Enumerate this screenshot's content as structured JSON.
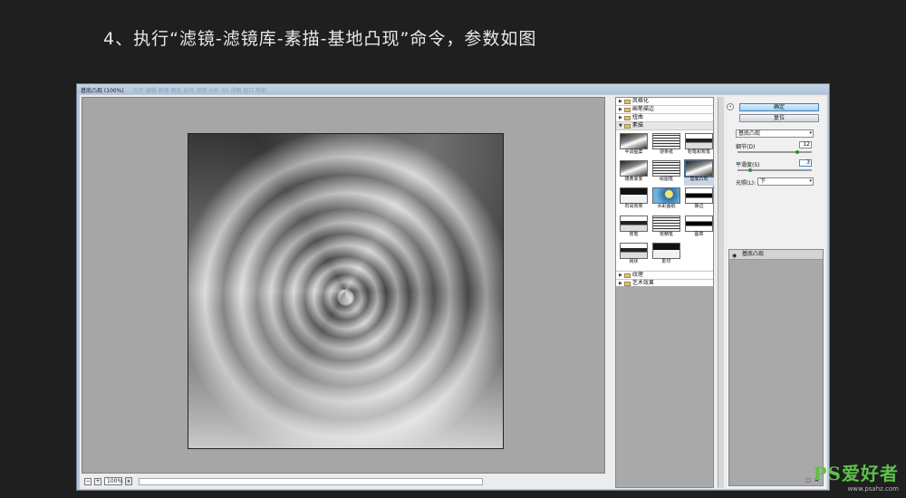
{
  "instruction": "4、执行“滤镜-滤镜库-素描-基地凸现”命令，参数如图",
  "dialog": {
    "title": "基底凸现 (100%)",
    "title_ghost": "文件 编辑 图像 图层 选择 滤镜 分析 3D 视图 窗口 帮助"
  },
  "statusbar": {
    "minus": "−",
    "plus": "+",
    "zoom": "100%",
    "dropdown": "▾"
  },
  "gallery": {
    "categories_top": [
      {
        "label": "风格化"
      },
      {
        "label": "画笔描边"
      },
      {
        "label": "扭曲"
      }
    ],
    "open_category": "素描",
    "thumbnails": [
      {
        "label": "半调图案",
        "style": "s1"
      },
      {
        "label": "便条纸",
        "style": "s2"
      },
      {
        "label": "粉笔和炭笔",
        "style": "s3"
      },
      {
        "label": "铬黄渐变",
        "style": "s1"
      },
      {
        "label": "绘图笔",
        "style": "s2"
      },
      {
        "label": "基底凸现",
        "style": "s1",
        "selected": true
      },
      {
        "label": "石膏效果",
        "style": "s4"
      },
      {
        "label": "水彩画纸",
        "style": "s5"
      },
      {
        "label": "撕边",
        "style": "s6"
      },
      {
        "label": "炭笔",
        "style": "s3"
      },
      {
        "label": "炭精笔",
        "style": "s2"
      },
      {
        "label": "图章",
        "style": "s6"
      },
      {
        "label": "网状",
        "style": "s3"
      },
      {
        "label": "影印",
        "style": "s4"
      }
    ],
    "categories_bottom": [
      {
        "label": "纹理"
      },
      {
        "label": "艺术效果"
      }
    ]
  },
  "settings": {
    "ok_label": "确定",
    "reset_label": "复位",
    "toggle_label": "«",
    "filter_select": "基底凸现",
    "detail_label": "细节(D)",
    "detail_value": "12",
    "detail_fraction": 0.8,
    "smooth_label": "平滑度(S)",
    "smooth_value": "3",
    "smooth_fraction": 0.15,
    "light_label": "光照(L):",
    "light_value": "下",
    "layer_name": "基底凸现",
    "layer_new_icon": "□",
    "layer_delete_icon": "✖"
  },
  "icons": {
    "collapsed": "▶",
    "expanded": "▼",
    "eye": "◉"
  },
  "watermark": {
    "logo": "PS爱好者",
    "url": "www.psahz.com"
  }
}
